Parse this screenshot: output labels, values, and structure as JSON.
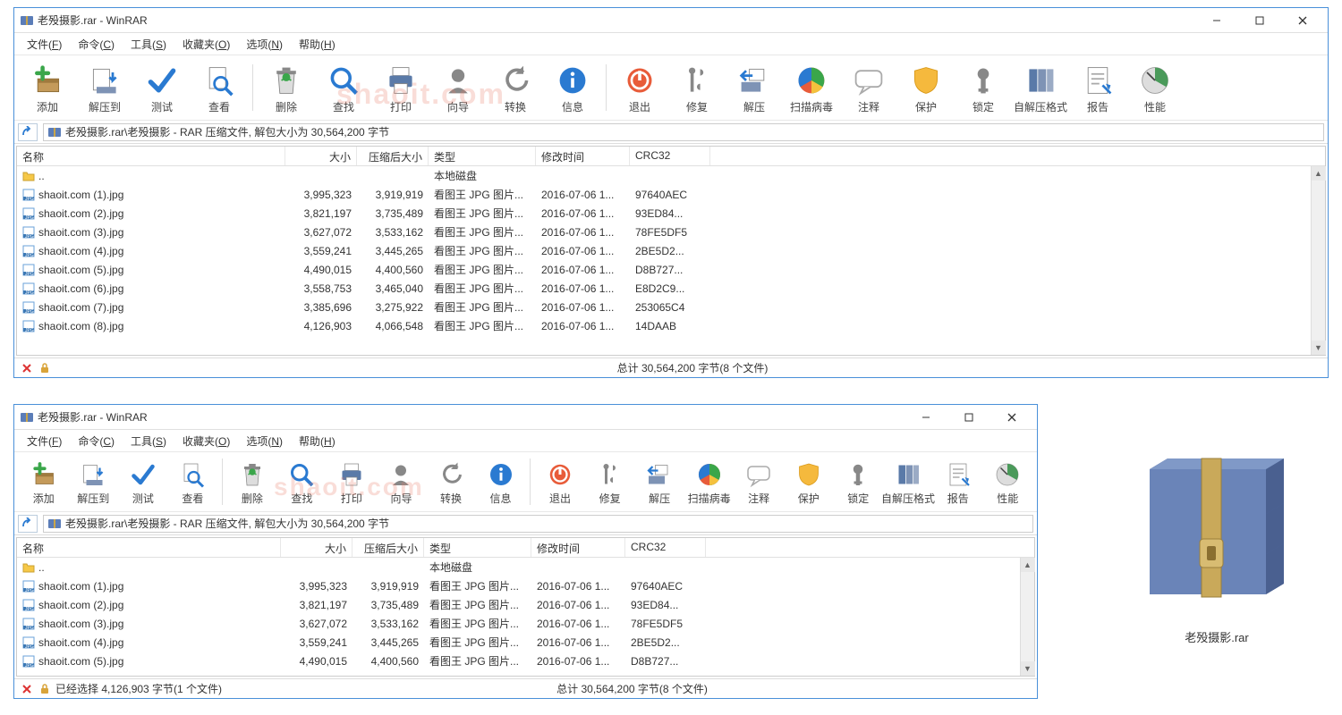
{
  "window": {
    "title": "老殁摄影.rar - WinRAR"
  },
  "menu": [
    "文件(F)",
    "命令(C)",
    "工具(S)",
    "收藏夹(O)",
    "选项(N)",
    "帮助(H)"
  ],
  "toolbar": [
    {
      "id": "add",
      "label": "添加"
    },
    {
      "id": "extract",
      "label": "解压到"
    },
    {
      "id": "test",
      "label": "测试"
    },
    {
      "id": "view",
      "label": "查看"
    },
    {
      "sep": true
    },
    {
      "id": "delete",
      "label": "删除"
    },
    {
      "id": "find",
      "label": "查找"
    },
    {
      "id": "print",
      "label": "打印"
    },
    {
      "id": "wizard",
      "label": "向导"
    },
    {
      "id": "convert",
      "label": "转换"
    },
    {
      "id": "info",
      "label": "信息"
    },
    {
      "sep": true
    },
    {
      "id": "exit",
      "label": "退出"
    },
    {
      "id": "repair",
      "label": "修复"
    },
    {
      "id": "extract2",
      "label": "解压"
    },
    {
      "id": "virus",
      "label": "扫描病毒"
    },
    {
      "id": "comment",
      "label": "注释"
    },
    {
      "id": "protect",
      "label": "保护"
    },
    {
      "id": "lock",
      "label": "锁定"
    },
    {
      "id": "sfx",
      "label": "自解压格式"
    },
    {
      "id": "report",
      "label": "报告"
    },
    {
      "id": "perf",
      "label": "性能"
    }
  ],
  "pathbar": {
    "text": "老殁摄影.rar\\老殁摄影 - RAR 压缩文件, 解包大小为 30,564,200 字节"
  },
  "columns": {
    "name": "名称",
    "size": "大小",
    "csize": "压缩后大小",
    "type": "类型",
    "date": "修改时间",
    "crc": "CRC32"
  },
  "parent_row": {
    "name": "..",
    "type": "本地磁盘"
  },
  "rows": [
    {
      "name": "shaoit.com (1).jpg",
      "size": "3,995,323",
      "csize": "3,919,919",
      "type": "看图王 JPG 图片...",
      "date": "2016-07-06 1...",
      "crc": "97640AEC"
    },
    {
      "name": "shaoit.com (2).jpg",
      "size": "3,821,197",
      "csize": "3,735,489",
      "type": "看图王 JPG 图片...",
      "date": "2016-07-06 1...",
      "crc": "93ED84..."
    },
    {
      "name": "shaoit.com (3).jpg",
      "size": "3,627,072",
      "csize": "3,533,162",
      "type": "看图王 JPG 图片...",
      "date": "2016-07-06 1...",
      "crc": "78FE5DF5"
    },
    {
      "name": "shaoit.com (4).jpg",
      "size": "3,559,241",
      "csize": "3,445,265",
      "type": "看图王 JPG 图片...",
      "date": "2016-07-06 1...",
      "crc": "2BE5D2..."
    },
    {
      "name": "shaoit.com (5).jpg",
      "size": "4,490,015",
      "csize": "4,400,560",
      "type": "看图王 JPG 图片...",
      "date": "2016-07-06 1...",
      "crc": "D8B727..."
    },
    {
      "name": "shaoit.com (6).jpg",
      "size": "3,558,753",
      "csize": "3,465,040",
      "type": "看图王 JPG 图片...",
      "date": "2016-07-06 1...",
      "crc": "E8D2C9..."
    },
    {
      "name": "shaoit.com (7).jpg",
      "size": "3,385,696",
      "csize": "3,275,922",
      "type": "看图王 JPG 图片...",
      "date": "2016-07-06 1...",
      "crc": "253065C4"
    },
    {
      "name": "shaoit.com (8).jpg",
      "size": "4,126,903",
      "csize": "4,066,548",
      "type": "看图王 JPG 图片...",
      "date": "2016-07-06 1...",
      "crc": "14DAAB"
    }
  ],
  "rows2_visible": 5,
  "status": {
    "w1_center": "总计 30,564,200 字节(8 个文件)",
    "w2_left": "已经选择 4,126,903 字节(1 个文件)",
    "w2_center": "总计 30,564,200 字节(8 个文件)"
  },
  "desktop_icon_label": "老殁摄影.rar",
  "watermark": "shaoit.com"
}
